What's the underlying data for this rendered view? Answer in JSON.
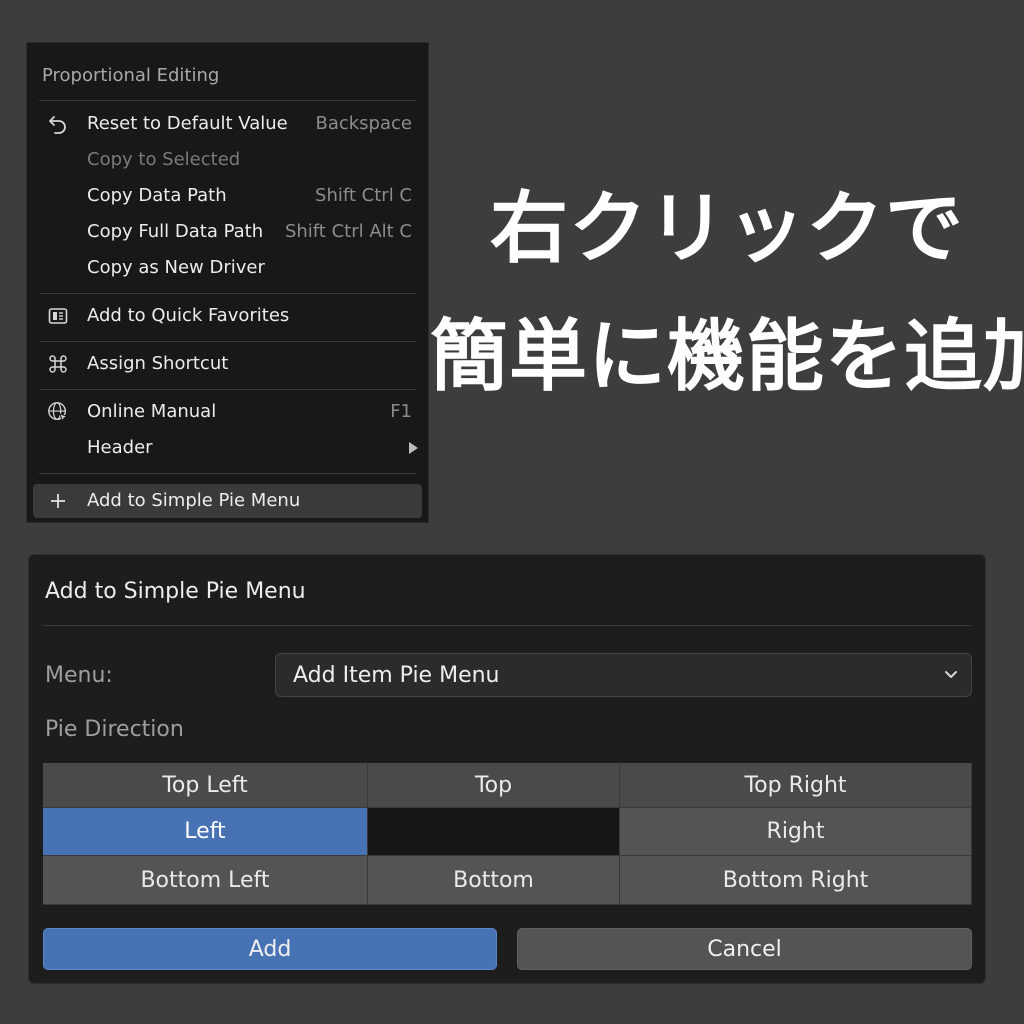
{
  "context_menu": {
    "title": "Proportional Editing",
    "items": [
      {
        "label": "Reset to Default Value",
        "shortcut": "Backspace",
        "icon": "reset-icon"
      },
      {
        "label": "Copy to Selected",
        "shortcut": "",
        "disabled": true
      },
      {
        "label": "Copy Data Path",
        "shortcut": "Shift Ctrl C"
      },
      {
        "label": "Copy Full Data Path",
        "shortcut": "Shift Ctrl Alt C"
      },
      {
        "label": "Copy as New Driver",
        "shortcut": ""
      },
      {
        "label": "Add to Quick Favorites",
        "shortcut": "",
        "icon": "quick-favorites-icon"
      },
      {
        "label": "Assign Shortcut",
        "shortcut": "",
        "icon": "command-key-icon"
      },
      {
        "label": "Online Manual",
        "shortcut": "F1",
        "icon": "globe-icon"
      },
      {
        "label": "Header",
        "shortcut": "",
        "submenu": true
      },
      {
        "label": "Add to Simple Pie Menu",
        "shortcut": "",
        "icon": "plus-icon",
        "highlighted": true
      }
    ]
  },
  "caption": {
    "line1": "右クリックで",
    "line2": "簡単に機能を追加"
  },
  "dialog": {
    "title": "Add to Simple Pie Menu",
    "menu_label": "Menu:",
    "menu_value": "Add Item Pie Menu",
    "pie_direction_label": "Pie Direction",
    "directions": {
      "top_left": "Top Left",
      "top": "Top",
      "top_right": "Top Right",
      "left": "Left",
      "right": "Right",
      "bottom_left": "Bottom Left",
      "bottom": "Bottom",
      "bottom_right": "Bottom Right"
    },
    "selected_direction": "Left",
    "add_label": "Add",
    "cancel_label": "Cancel"
  },
  "colors": {
    "background": "#3d3d3d",
    "menu_bg": "#181818",
    "accent_blue": "#4772b3",
    "button_gray": "#545454"
  }
}
